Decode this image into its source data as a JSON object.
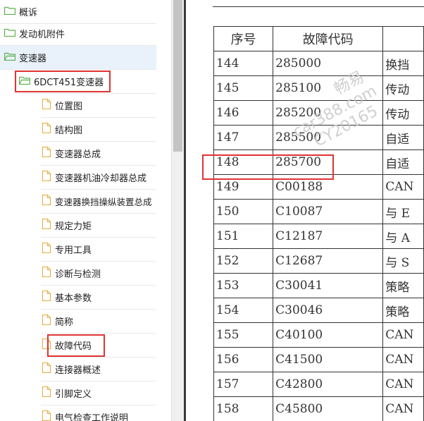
{
  "tree": {
    "items": [
      {
        "label": "概诉",
        "type": "folder"
      },
      {
        "label": "发动机附件",
        "type": "folder"
      },
      {
        "label": "变速器",
        "type": "folder",
        "selected": true
      },
      {
        "label": "6DCT451变速器",
        "type": "folder"
      },
      {
        "label": "位置图",
        "type": "doc"
      },
      {
        "label": "结构图",
        "type": "doc"
      },
      {
        "label": "变速器总成",
        "type": "doc"
      },
      {
        "label": "变速器机油冷却器总成",
        "type": "doc"
      },
      {
        "label": "变速器换挡操纵装置总成",
        "type": "doc"
      },
      {
        "label": "规定力矩",
        "type": "doc"
      },
      {
        "label": "专用工具",
        "type": "doc"
      },
      {
        "label": "诊断与检测",
        "type": "doc"
      },
      {
        "label": "基本参数",
        "type": "doc"
      },
      {
        "label": "简称",
        "type": "doc"
      },
      {
        "label": "故障代码",
        "type": "doc"
      },
      {
        "label": "连接器概述",
        "type": "doc"
      },
      {
        "label": "引脚定义",
        "type": "doc"
      },
      {
        "label": "电气检查工作说明",
        "type": "doc"
      }
    ]
  },
  "table": {
    "headers": [
      "序号",
      "故障代码",
      ""
    ],
    "rows": [
      [
        "144",
        "285000",
        "换挡"
      ],
      [
        "145",
        "285100",
        "传动"
      ],
      [
        "146",
        "285200",
        "传动"
      ],
      [
        "147",
        "285500",
        "自适"
      ],
      [
        "148",
        "285700",
        "自适"
      ],
      [
        "149",
        "C00188",
        "CAN"
      ],
      [
        "150",
        "C10087",
        "与 E"
      ],
      [
        "151",
        "C12187",
        "与 A"
      ],
      [
        "152",
        "C12687",
        "与 S"
      ],
      [
        "153",
        "C30041",
        "策略"
      ],
      [
        "154",
        "C30046",
        "策略"
      ],
      [
        "155",
        "C40100",
        "CAN"
      ],
      [
        "156",
        "C41500",
        "CAN"
      ],
      [
        "157",
        "C42800",
        "CAN"
      ],
      [
        "158",
        "C45800",
        "CAN"
      ]
    ]
  },
  "watermark": {
    "line1": "畅易",
    "line2": "car388.com",
    "line3": "CY20165"
  },
  "colors": {
    "folder": "#5bb04a",
    "doc": "#e8a93c",
    "highlight": "#e03434",
    "selected_bg": "#e9f1fb"
  }
}
